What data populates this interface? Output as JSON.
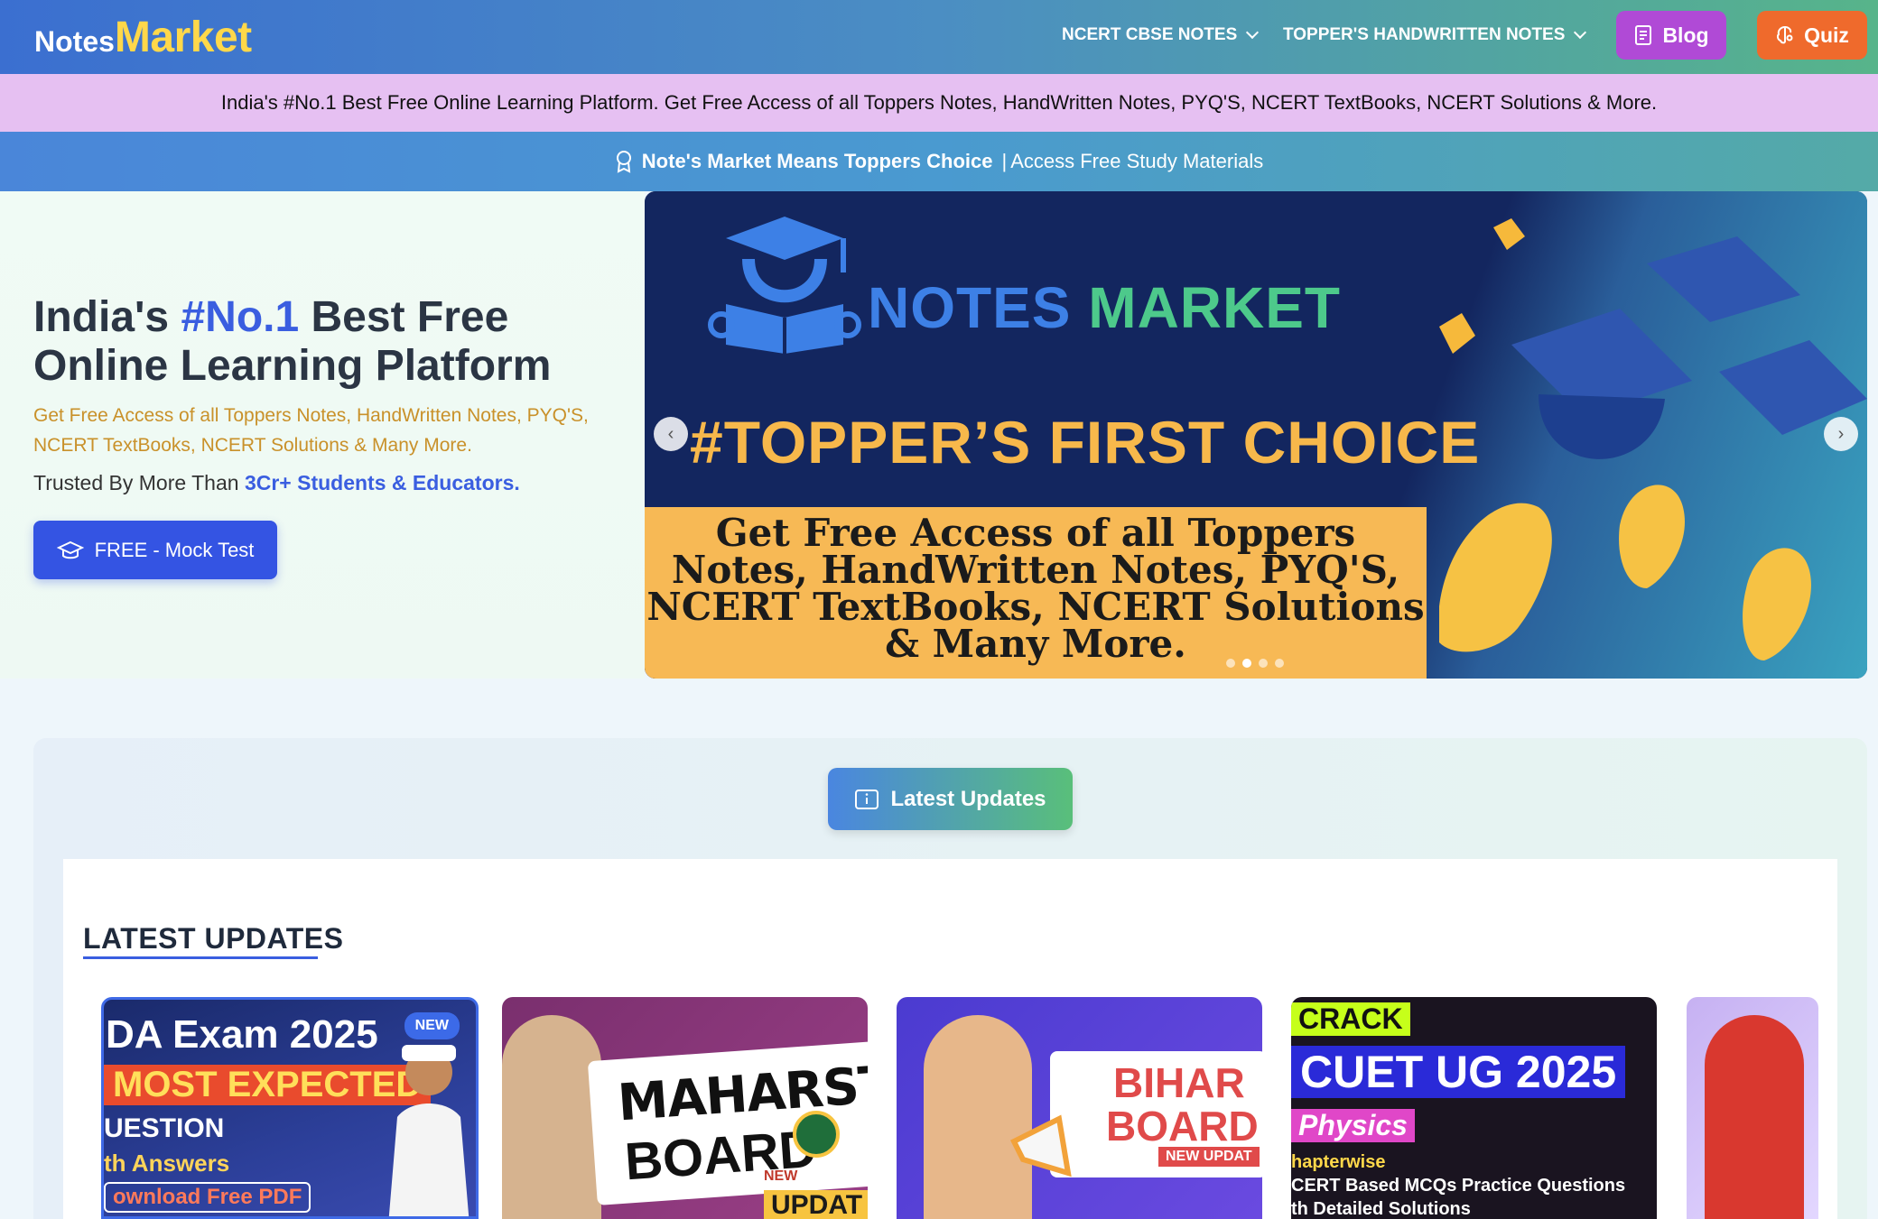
{
  "brand": {
    "part1": "Notes",
    "part2": "Market"
  },
  "nav": {
    "items": [
      {
        "label": "NCERT CBSE NOTES"
      },
      {
        "label": "TOPPER'S HANDWRITTEN NOTES"
      }
    ],
    "blog_label": "Blog",
    "quiz_label": "Quiz"
  },
  "banner_pink": "India's #No.1 Best Free Online Learning Platform. Get Free Access of all Toppers Notes, HandWritten Notes, PYQ'S, NCERT TextBooks, NCERT Solutions & More.",
  "banner_blue": {
    "strong": "Note's Market Means Toppers Choice",
    "sep": "|",
    "rest": "Access Free Study Materials"
  },
  "hero": {
    "title_pre": "India's ",
    "title_accent": "#No.1",
    "title_post": " Best Free Online Learning Platform",
    "subtitle": "Get Free Access of all Toppers Notes, HandWritten Notes, PYQ'S, NCERT TextBooks, NCERT Solutions & Many More.",
    "trust_pre": "Trusted By More Than ",
    "trust_hl": "3Cr+ Students & Educators.",
    "mock_label": "FREE - Mock Test"
  },
  "slider": {
    "logo_a": "NOTES ",
    "logo_b": "MARKET",
    "headline": "#TOPPER’S FIRST CHOICE",
    "box_text": "Get Free Access of all Toppers Notes, HandWritten Notes, PYQ'S, NCERT TextBooks, NCERT Solutions & Many More.",
    "prev": "‹",
    "next": "›",
    "dots": 4,
    "active_dot": 1
  },
  "updates": {
    "button_label": "Latest Updates",
    "heading": "LATEST UPDATES",
    "cards": [
      {
        "badge": "NEW",
        "l1": "DA Exam 2025",
        "l2": "MOST EXPECTED",
        "l3": "UESTION",
        "l4": "th Answers",
        "l5": "ownload Free PDF"
      },
      {
        "b1": "MAHARSTRA",
        "b2": "BOARD",
        "b3s": "NEW",
        "b3": "UPDAT"
      },
      {
        "s1": "BIHAR",
        "s2": "BOARD",
        "s3": "NEW UPDAT"
      },
      {
        "c1": "CRACK",
        "c2": "CUET UG 2025",
        "c3": "Physics",
        "c4": "hapterwise",
        "c5": "CERT Based MCQs Practice Questions",
        "c6": "th Detailed Solutions"
      },
      {}
    ]
  }
}
